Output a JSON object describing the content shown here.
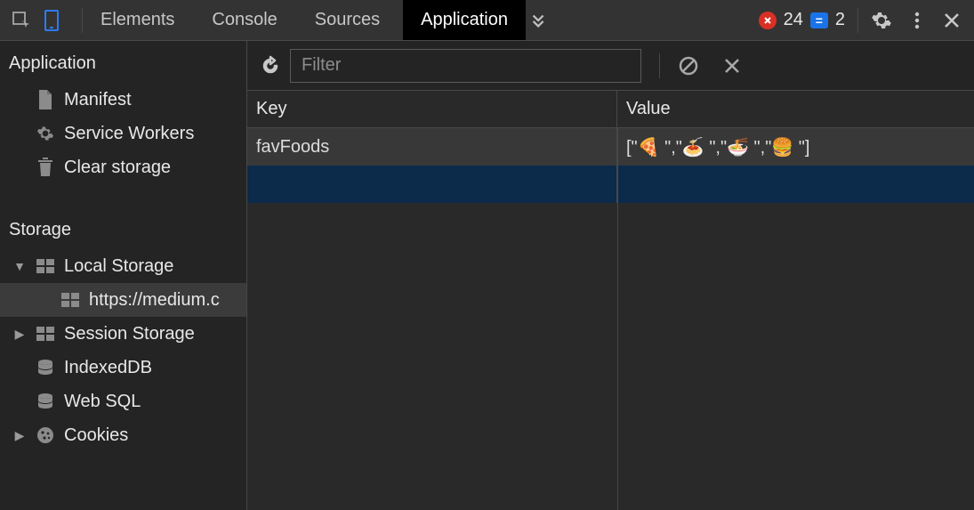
{
  "topbar": {
    "tabs": [
      "Elements",
      "Console",
      "Sources",
      "Application"
    ],
    "active_tab_index": 3,
    "errors_count": "24",
    "messages_count": "2"
  },
  "filter": {
    "placeholder": "Filter"
  },
  "sidebar": {
    "section_application": "Application",
    "items_application": {
      "manifest": "Manifest",
      "service_workers": "Service Workers",
      "clear_storage": "Clear storage"
    },
    "section_storage": "Storage",
    "items_storage": {
      "local_storage": "Local Storage",
      "local_storage_origin": "https://medium.c",
      "session_storage": "Session Storage",
      "indexed_db": "IndexedDB",
      "web_sql": "Web SQL",
      "cookies": "Cookies"
    }
  },
  "table": {
    "header_key": "Key",
    "header_value": "Value",
    "rows": [
      {
        "key": "favFoods",
        "value": "[\"🍕 \",\"🍝 \",\"🍜 \",\"🍔 \"]"
      }
    ]
  }
}
